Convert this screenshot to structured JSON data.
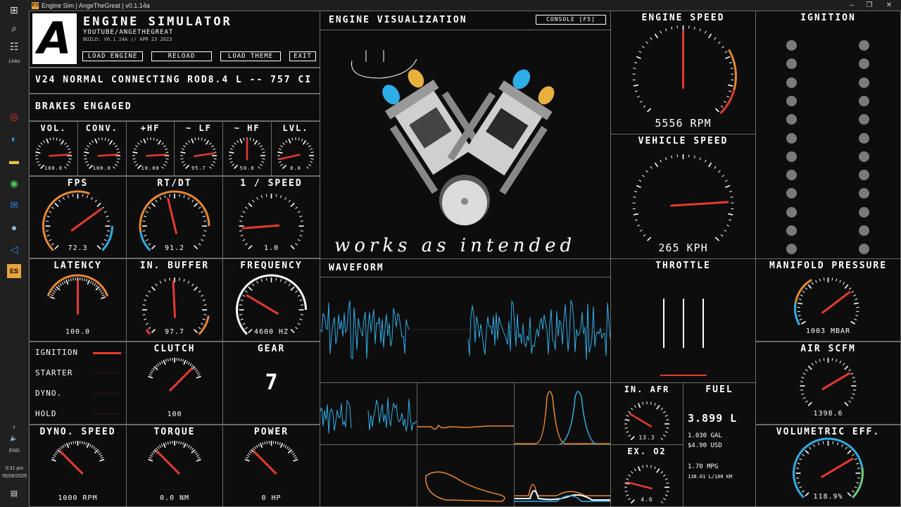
{
  "window": {
    "title": "Engine Sim | AngeTheGreat | v0.1.14a",
    "app_icon": "ES"
  },
  "taskbar": {
    "links_label": "Links",
    "lang": "ENG",
    "time": "5:31 pm",
    "date": "05/06/2025"
  },
  "header": {
    "logo": "A",
    "title": "ENGINE SIMULATOR",
    "subtitle": "YOUTUBE/ANGETHEGREAT",
    "build": "BUILD: V0.1.14A // APR 23 2023",
    "buttons": [
      "LOAD ENGINE",
      "RELOAD",
      "LOAD THEME",
      "EXIT"
    ]
  },
  "engine_name": "V24 NORMAL CONNECTING ROD",
  "engine_size": "8.4 L -- 757 CI",
  "brakes": "BRAKES ENGAGED",
  "mini_gauges": [
    {
      "title": "VOL.",
      "value": "100.0",
      "frac": 0.82
    },
    {
      "title": "CONV.",
      "value": "100.0",
      "frac": 0.82
    },
    {
      "title": "+HF",
      "value": "10.00",
      "frac": 0.82
    },
    {
      "title": "~ LF",
      "value": "95.7",
      "frac": 0.8
    },
    {
      "title": "~ HF",
      "value": "50.0",
      "frac": 0.5
    },
    {
      "title": "LVL.",
      "value": "0.0",
      "frac": 0.12
    }
  ],
  "gauges": {
    "fps": {
      "title": "FPS",
      "value": "72.3",
      "frac": 0.7
    },
    "rtdt": {
      "title": "RT/DT",
      "value": "91.2",
      "frac": 0.45
    },
    "speed_inv": {
      "title": "1 / SPEED",
      "value": "1.0",
      "frac": 0.15
    },
    "latency": {
      "title": "LATENCY",
      "value": "100.0",
      "frac": 0.5
    },
    "in_buffer": {
      "title": "IN. BUFFER",
      "value": "97.7",
      "frac": 0.49
    },
    "frequency": {
      "title": "FREQUENCY",
      "value": "4600 HZ",
      "frac": 0.28
    },
    "clutch": {
      "title": "CLUTCH",
      "value": "100",
      "frac": 0.82
    },
    "dyno_speed": {
      "title": "DYNO. SPEED",
      "value": "1000 RPM",
      "frac": 0.18
    },
    "torque": {
      "title": "TORQUE",
      "value": "0.0 NM",
      "frac": 0.18
    },
    "power": {
      "title": "POWER",
      "value": "0 HP",
      "frac": 0.18
    },
    "engine_speed": {
      "title": "ENGINE SPEED",
      "value": "5556 RPM",
      "frac": 0.5
    },
    "vehicle_speed": {
      "title": "VEHICLE SPEED",
      "value": "265 KPH",
      "frac": 0.82
    },
    "manifold": {
      "title": "MANIFOLD PRESSURE",
      "value": "1003 MBAR",
      "frac": 0.72
    },
    "air_scfm": {
      "title": "AIR SCFM",
      "value": "1398.6",
      "frac": 0.72
    },
    "vol_eff": {
      "title": "VOLUMETRIC EFF.",
      "value": "118.9%",
      "frac": 0.72
    },
    "in_afr": {
      "title": "IN. AFR",
      "value": "13.3",
      "frac": 0.28
    },
    "ex_o2": {
      "title": "EX. O2",
      "value": "4.6",
      "frac": 0.22
    }
  },
  "controls": {
    "ignition": "IGNITION",
    "starter": "STARTER",
    "dyno": "DYNO.",
    "hold": "HOLD"
  },
  "gear": {
    "title": "GEAR",
    "value": "7"
  },
  "visualization": {
    "title": "ENGINE VISUALIZATION",
    "console_button": "CONSOLE [F5]",
    "annotation": "works as intended"
  },
  "waveform_title": "WAVEFORM",
  "throttle_title": "THROTTLE",
  "ignition_title": "IGNITION",
  "fuel": {
    "title": "FUEL",
    "liters": "3.899 L",
    "gal": "1.030 GAL",
    "usd": "$4.90 USD",
    "mpg": "1.70 MPG",
    "l100": "138.01 L/100 KM"
  },
  "colors": {
    "needle": "#e8392e",
    "orange": "#e8892e",
    "blue": "#2eaee8",
    "green": "#6ad17a",
    "border": "#6a6a6a"
  }
}
